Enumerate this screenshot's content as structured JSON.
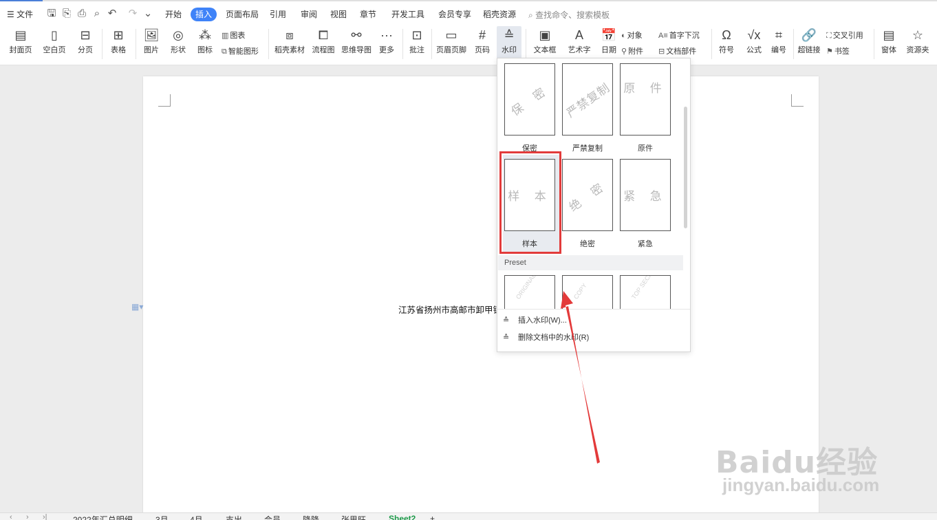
{
  "menu": {
    "file_label": "文件",
    "tabs": [
      "开始",
      "插入",
      "页面布局",
      "引用",
      "审阅",
      "视图",
      "章节",
      "开发工具",
      "会员专享",
      "稻壳资源"
    ],
    "active_tab": "插入",
    "search_placeholder": "查找命令、搜索模板"
  },
  "ribbon": {
    "cover": "封面页",
    "blank": "空白页",
    "page_break": "分页",
    "table": "表格",
    "picture": "图片",
    "shape": "形状",
    "icon": "图标",
    "chart": "图表",
    "smart_graphic": "智能图形",
    "daoke": "稻壳素材",
    "flowchart": "流程图",
    "mindmap": "思维导图",
    "more": "更多",
    "comment": "批注",
    "header_footer": "页眉页脚",
    "page_num": "页码",
    "watermark": "水印",
    "textbox": "文本框",
    "wordart": "艺术字",
    "date": "日期",
    "object": "对象",
    "attachment": "附件",
    "dropcap": "首字下沉",
    "doc_parts": "文档部件",
    "symbol": "符号",
    "formula": "公式",
    "numbering": "编号",
    "hyperlink": "超链接",
    "crossref": "交叉引用",
    "bookmark": "书签",
    "window": "窗体",
    "resources": "资源夹"
  },
  "document": {
    "text": "江苏省扬州市高邮市卸甲镇"
  },
  "watermark_menu": {
    "items": [
      {
        "label": "保密",
        "text": "保 密"
      },
      {
        "label": "严禁复制",
        "text": "严禁复制"
      },
      {
        "label": "原件",
        "text": "原 件"
      },
      {
        "label": "样本",
        "text": "样 本"
      },
      {
        "label": "绝密",
        "text": "绝 密"
      },
      {
        "label": "紧急",
        "text": "紧 急"
      }
    ],
    "selected": "样本",
    "preset_header": "Preset",
    "preset_items": [
      "ORIGINAL",
      "COPY",
      "TOP SECRET"
    ],
    "insert_label": "插入水印(W)...",
    "delete_label": "删除文档中的水印(R)"
  },
  "sheets": {
    "tabs": [
      "2022年汇总明细",
      "3月",
      "4月",
      "支出",
      "会员",
      "降降",
      "张思旺",
      "Sheet2"
    ],
    "active": "Sheet2"
  },
  "watermark_logo": {
    "text": "Baidu经验",
    "url": "jingyan.baidu.com"
  },
  "colors": {
    "accent": "#3f83f8",
    "highlight": "#e23b3b",
    "active_sheet": "#1e9a4a"
  }
}
